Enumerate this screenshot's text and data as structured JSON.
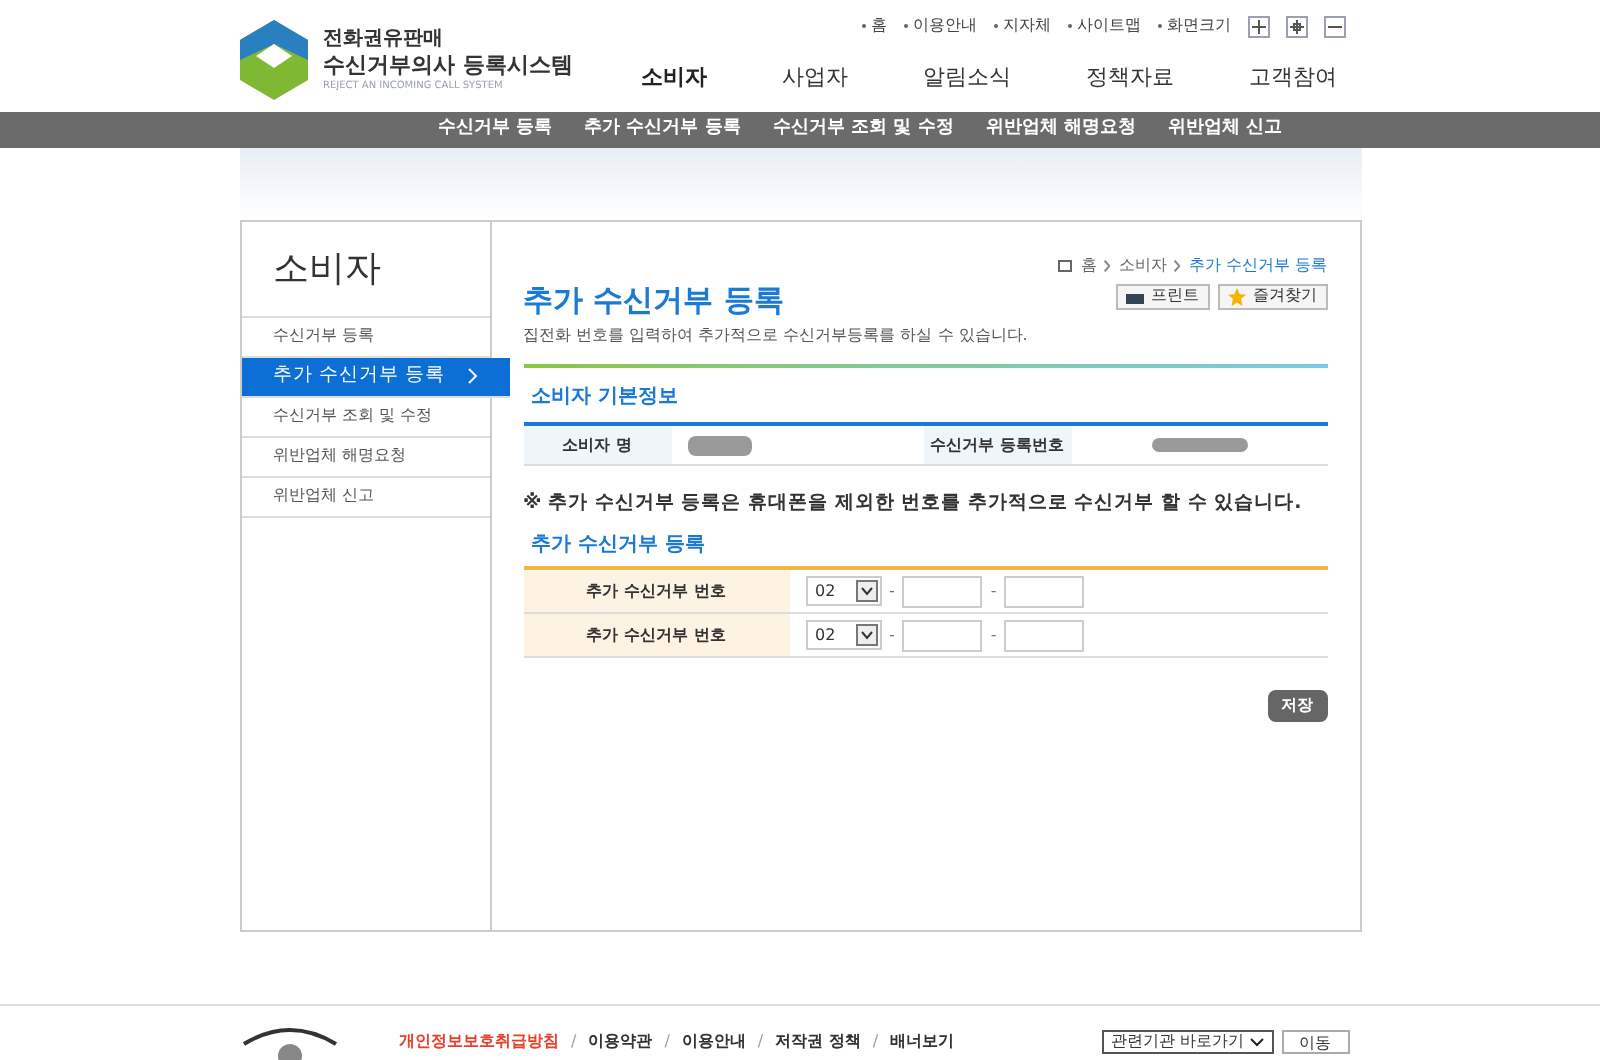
{
  "logo": {
    "line1": "전화권유판매",
    "line2": "수신거부의사 등록시스템",
    "line3": "REJECT AN INCOMING CALL SYSTEM"
  },
  "util_links": [
    "홈",
    "이용안내",
    "지자체",
    "사이트맵",
    "화면크기"
  ],
  "main_nav": [
    {
      "label": "소비자",
      "selected": true
    },
    {
      "label": "사업자",
      "selected": false
    },
    {
      "label": "알림소식",
      "selected": false
    },
    {
      "label": "정책자료",
      "selected": false
    },
    {
      "label": "고객참여",
      "selected": false
    }
  ],
  "sub_nav": [
    "수신거부 등록",
    "추가 수신거부 등록",
    "수신거부 조회 및 수정",
    "위반업체 해명요청",
    "위반업체 신고"
  ],
  "sidebar": {
    "title": "소비자",
    "items": [
      {
        "label": "수신거부 등록",
        "selected": false
      },
      {
        "label": "추가 수신거부 등록",
        "selected": true
      },
      {
        "label": "수신거부 조회 및 수정",
        "selected": false
      },
      {
        "label": "위반업체 해명요청",
        "selected": false
      },
      {
        "label": "위반업체 신고",
        "selected": false
      }
    ]
  },
  "breadcrumb": [
    "홈",
    "소비자",
    "추가 수신거부 등록"
  ],
  "page_buttons": [
    "프린트",
    "즐겨찾기"
  ],
  "page_title": "추가 수신거부 등록",
  "description": "집전화 번호를 입력하여 추가적으로 수신거부등록를 하실 수 있습니다.",
  "basic_info": {
    "title": "소비자 기본정보",
    "fields": [
      "소비자 명",
      "수신거부 등록번호"
    ]
  },
  "notice": "※ 추가 수신거부 등록은 휴대폰을 제외한 번호를 추가적으로 수신거부 할 수 있습니다.",
  "add_section": {
    "title": "추가 수신거부 등록",
    "rows": [
      {
        "label": "추가 수신거부 번호",
        "area_code": "02"
      },
      {
        "label": "추가 수신거부 번호",
        "area_code": "02"
      }
    ]
  },
  "number_separator": "-",
  "save_button": "저장",
  "footer": {
    "links": [
      {
        "label": "개인정보보호취급방침",
        "highlight": true
      },
      {
        "label": "이용약관",
        "highlight": false
      },
      {
        "label": "이용안내",
        "highlight": false
      },
      {
        "label": "저작권 정책",
        "highlight": false
      },
      {
        "label": "배너보기",
        "highlight": false
      }
    ],
    "link_separator": "/",
    "related_select": "관련기관 바로가기",
    "go_button": "이동"
  }
}
